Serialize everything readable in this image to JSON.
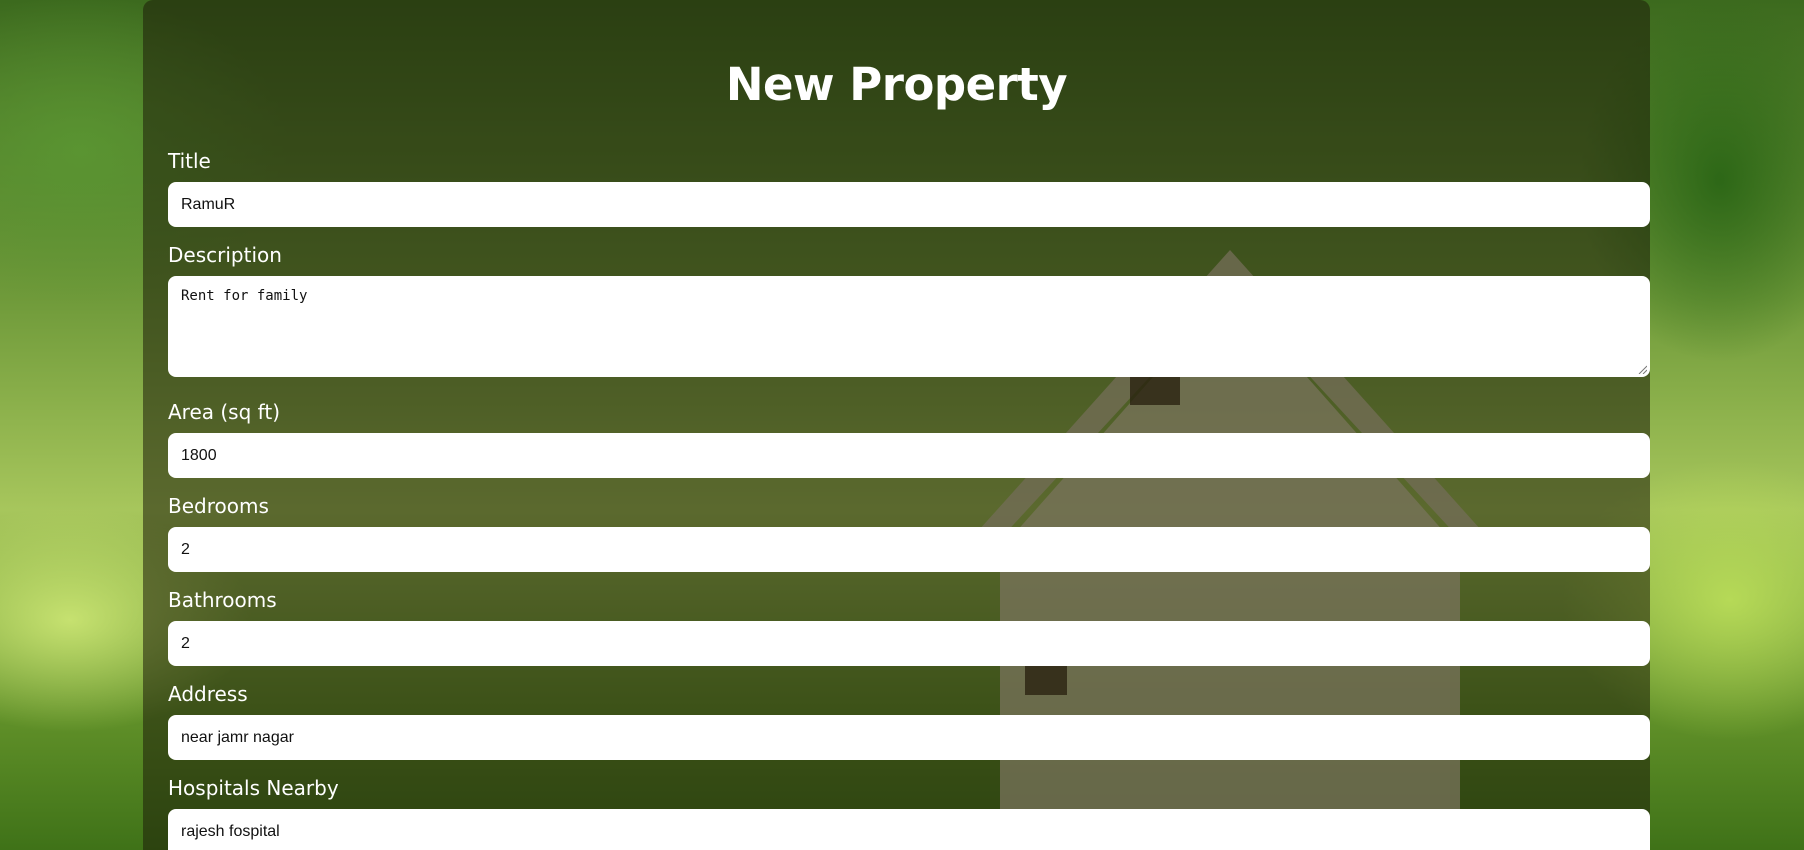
{
  "form": {
    "title": "New Property",
    "fields": [
      {
        "label": "Title",
        "value": "RamuR"
      },
      {
        "label": "Description",
        "value": "Rent for family"
      },
      {
        "label": "Area (sq ft)",
        "value": "1800"
      },
      {
        "label": "Bedrooms",
        "value": "2"
      },
      {
        "label": "Bathrooms",
        "value": "2"
      },
      {
        "label": "Address",
        "value": "near jamr nagar"
      },
      {
        "label": "Hospitals Nearby",
        "value": "rajesh fospital"
      }
    ]
  },
  "colors": {
    "card_overlay": "#1e1e0a",
    "label_text": "#ffffff",
    "input_bg": "#ffffff"
  }
}
